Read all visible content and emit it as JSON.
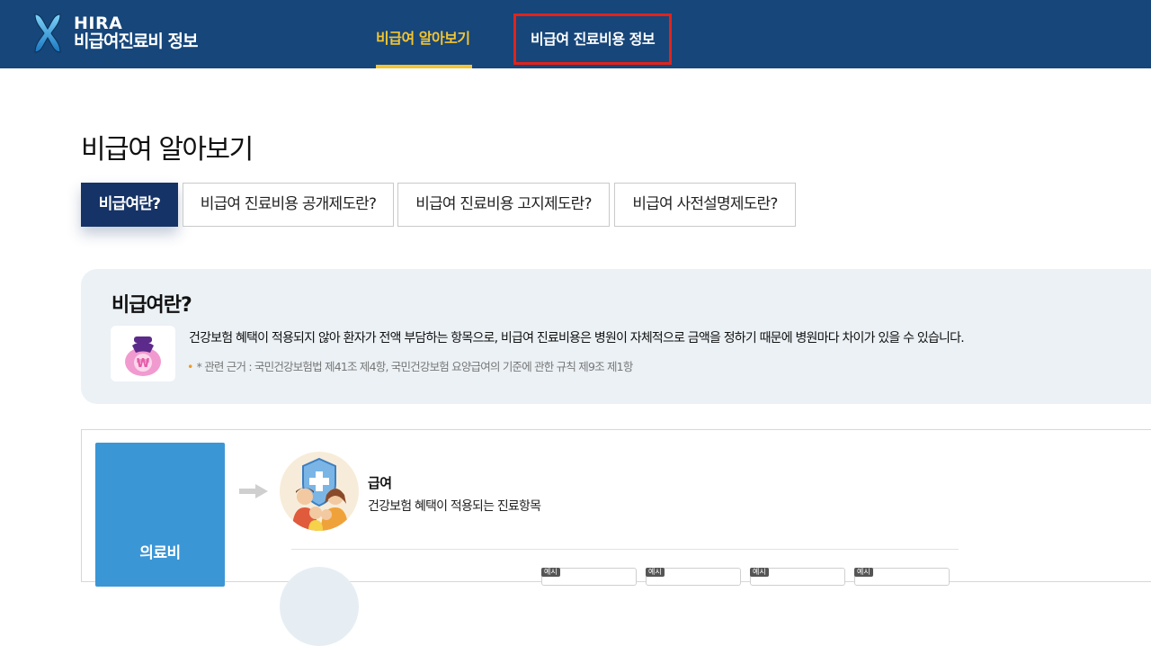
{
  "header": {
    "logo_line1": "HIRA",
    "logo_line2": "비급여진료비 정보",
    "nav": [
      {
        "label": "비급여 알아보기",
        "active": true
      },
      {
        "label": "비급여 진료비용 정보",
        "highlighted": true
      }
    ],
    "colors": {
      "background": "#16467a",
      "active": "#f4c431",
      "highlight_border": "#e2231a"
    }
  },
  "page_title": "비급여 알아보기",
  "tabs": [
    {
      "label": "비급여란?",
      "active": true
    },
    {
      "label": "비급여 진료비용 공개제도란?",
      "active": false
    },
    {
      "label": "비급여 진료비용 고지제도란?",
      "active": false
    },
    {
      "label": "비급여 사전설명제도란?",
      "active": false
    }
  ],
  "info": {
    "title": "비급여란?",
    "icon": "money-bag-icon",
    "description": "건강보험 혜택이 적용되지 않아 환자가 전액 부담하는 항목으로, 비급여 진료비용은 병원이 자체적으로 금액을 정하기 때문에 병원마다 차이가 있을 수 있습니다.",
    "note": "* 관련 근거 : 국민건강보험법 제41조 제4항, 국민건강보험 요양급여의 기준에 관한 규칙 제9조 제1항"
  },
  "diagram": {
    "root_label": "의료비",
    "benefit": {
      "icon": "family-shield-icon",
      "title": "급여",
      "description": "건강보험 혜택이 적용되는 진료항목"
    },
    "example_tag": "예시"
  }
}
